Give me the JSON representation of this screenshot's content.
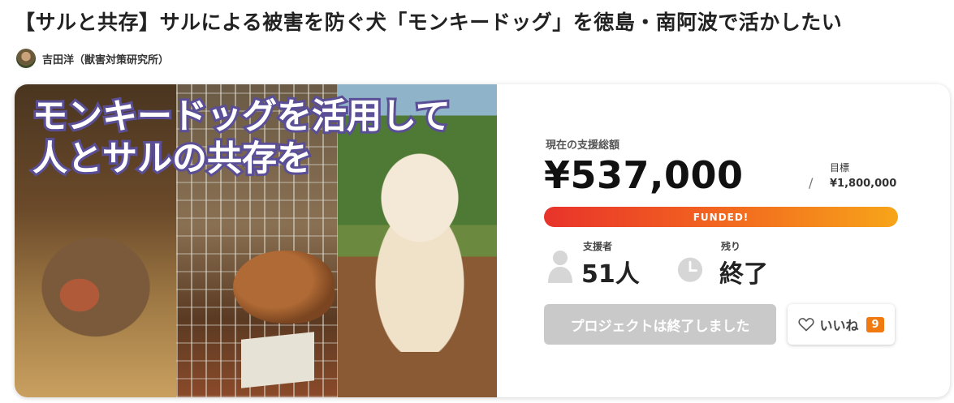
{
  "page": {
    "title": "【サルと共存】サルによる被害を防ぐ犬「モンキードッグ」を徳島・南阿波で活かしたい"
  },
  "owner": {
    "name": "吉田洋（獣害対策研究所）"
  },
  "hero": {
    "line1": "モンキードッグを活用して",
    "line2": "人とサルの共存を"
  },
  "funding": {
    "current_label": "現在の支援総額",
    "amount": "¥537,000",
    "slash": "/",
    "goal_label": "目標",
    "goal_amount": "¥1,800,000",
    "status": "FUNDED!",
    "progress_percent": 100
  },
  "stats": {
    "supporters_label": "支援者",
    "supporters_value": "51人",
    "remaining_label": "残り",
    "remaining_value": "終了"
  },
  "actions": {
    "ended_label": "プロジェクトは終了しました",
    "like_label": "いいね",
    "like_count": "9"
  },
  "colors": {
    "accent_orange": "#f07a10",
    "progress_start": "#e8332b",
    "progress_end": "#f7a51a",
    "hero_text_outline": "#5a4f96",
    "disabled_button": "#c9c9c9"
  }
}
